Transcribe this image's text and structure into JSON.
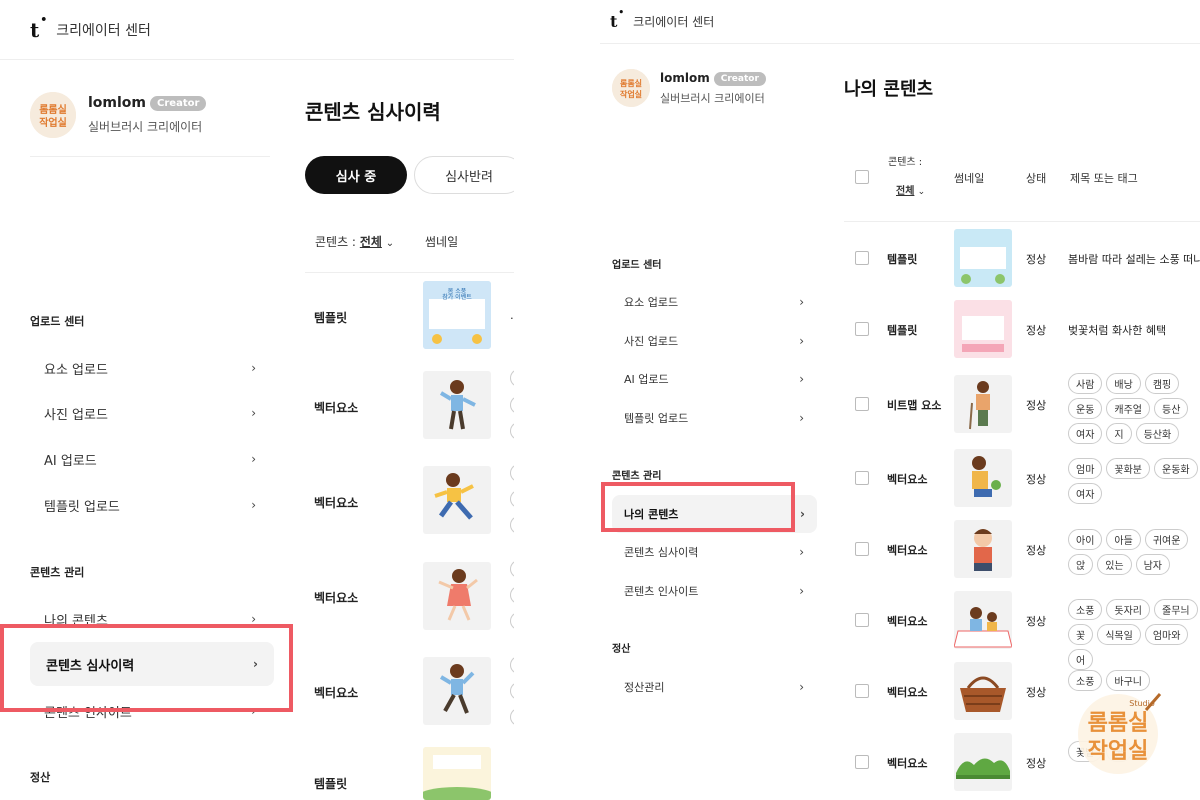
{
  "brand": {
    "symbol": "t",
    "label": "크리에이터 센터"
  },
  "profile": {
    "username": "lomlom",
    "badge": "Creator",
    "tier": "실버브러시 크리에이터",
    "avatar_text": [
      "롬롬실",
      "작업실"
    ]
  },
  "nav": {
    "upload_heading": "업로드 센터",
    "upload_items": [
      "요소 업로드",
      "사진 업로드",
      "AI 업로드",
      "템플릿 업로드"
    ],
    "content_heading": "콘텐츠 관리",
    "content_items": [
      "나의 콘텐츠",
      "콘텐츠 심사이력",
      "콘텐츠 인사이트"
    ],
    "settle_heading": "정산",
    "settle_items": [
      "정산관리"
    ]
  },
  "left_main": {
    "title": "콘텐츠 심사이력",
    "tabs": [
      "심사 중",
      "심사반려"
    ],
    "col_filter_label": "콘텐츠 :",
    "col_filter_value": "전체",
    "col_thumb": "썸네일",
    "rows": [
      {
        "type": "템플릿",
        "thumb_text": [
          "봄 소풍",
          "참가 이벤트"
        ]
      },
      {
        "type": "벡터요소"
      },
      {
        "type": "벡터요소"
      },
      {
        "type": "벡터요소"
      },
      {
        "type": "벡터요소"
      },
      {
        "type": "템플릿"
      }
    ]
  },
  "right_main": {
    "title": "나의 콘텐츠",
    "col_filter_label": "콘텐츠 :",
    "col_filter_value": "전체",
    "col_thumb": "썸네일",
    "col_status": "상태",
    "col_title": "제목 또는 태그",
    "rows": [
      {
        "type": "템플릿",
        "status": "정상",
        "title": "봄바람 따라 설레는 소풍 떠나요",
        "tags": [],
        "thumb": "poster-blue"
      },
      {
        "type": "템플릿",
        "status": "정상",
        "title": "벚꽃처럼 화사한 혜택",
        "tags": [],
        "thumb": "poster-pink"
      },
      {
        "type": "비트맵 요소",
        "status": "정상",
        "title": "",
        "tags": [
          "사람",
          "배낭",
          "캠핑",
          "운동",
          "캐주얼",
          "등산",
          "여자",
          "지",
          "등산화"
        ],
        "thumb": "hiker"
      },
      {
        "type": "벡터요소",
        "status": "정상",
        "title": "",
        "tags": [
          "엄마",
          "꽃화분",
          "운동화",
          "여자"
        ],
        "thumb": "mom-plant"
      },
      {
        "type": "벡터요소",
        "status": "정상",
        "title": "",
        "tags": [
          "아이",
          "아들",
          "귀여운",
          "앉",
          "있는",
          "남자"
        ],
        "thumb": "boy"
      },
      {
        "type": "벡터요소",
        "status": "정상",
        "title": "",
        "tags": [
          "소풍",
          "돗자리",
          "줄무늬",
          "꽃",
          "식목일",
          "엄마와",
          "어"
        ],
        "thumb": "picnic"
      },
      {
        "type": "벡터요소",
        "status": "정상",
        "title": "",
        "tags": [
          "소풍",
          "바구니"
        ],
        "thumb": "basket"
      },
      {
        "type": "벡터요소",
        "status": "정상",
        "title": "",
        "tags": [
          "꽃밭",
          "꽃"
        ],
        "thumb": "grass"
      }
    ]
  },
  "watermark": {
    "line1": "롬롬실",
    "line2": "작업실",
    "small": "Studio"
  },
  "colors": {
    "highlight": "#ee5a63",
    "active_pill": "#111111",
    "badge": "#bdbdbd"
  }
}
